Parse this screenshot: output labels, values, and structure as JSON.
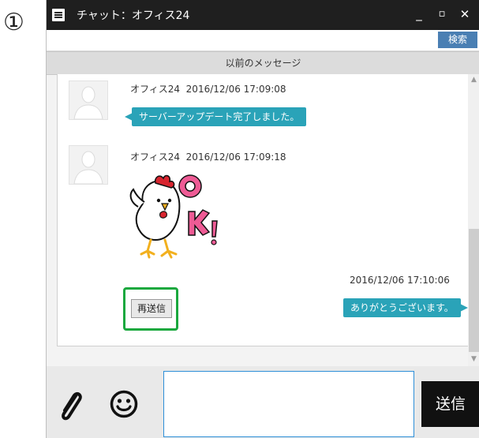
{
  "annotation": {
    "number": "①"
  },
  "window": {
    "title": "チャット：オフィス24",
    "controls": {
      "minimize": "_",
      "maximize": "▫",
      "close": "✕"
    }
  },
  "search": {
    "value": "",
    "placeholder": "",
    "button": "検索"
  },
  "history": {
    "previous_label": "以前のメッセージ"
  },
  "messages": [
    {
      "sender": "オフィス24",
      "timestamp": "2016/12/06 17:09:08",
      "text": "サーバーアップデート完了しました。"
    },
    {
      "sender": "オフィス24",
      "timestamp": "2016/12/06 17:09:18",
      "sticker": "chicken-ok-sticker"
    },
    {
      "timestamp": "2016/12/06 17:10:06",
      "text": "ありがとうございます。",
      "resend_label": "再送信"
    }
  ],
  "composer": {
    "value": "",
    "send_label": "送信"
  },
  "icons": {
    "attach": "paperclip-icon",
    "emoji": "smiley-icon",
    "menu": "menu-icon"
  },
  "colors": {
    "bubble": "#2aa3b8",
    "titlebar": "#1f1f1f",
    "search_button": "#4a7fb3",
    "highlight": "#1aa83e",
    "input_border": "#2d8fd8"
  }
}
